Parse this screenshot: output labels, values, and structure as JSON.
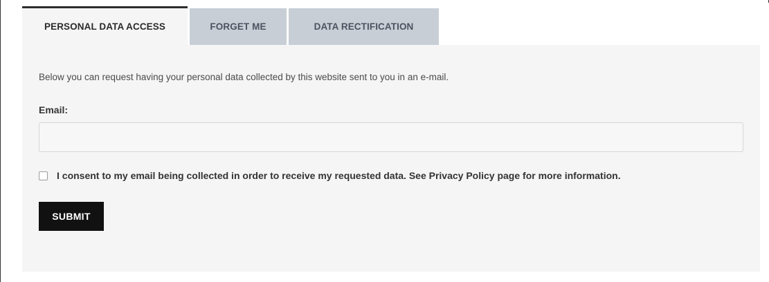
{
  "tabs": [
    {
      "label": "PERSONAL DATA ACCESS",
      "active": true
    },
    {
      "label": "FORGET ME",
      "active": false
    },
    {
      "label": "DATA RECTIFICATION",
      "active": false
    }
  ],
  "panel": {
    "intro": "Below you can request having your personal data collected by this website sent to you in an e-mail.",
    "email_label": "Email:",
    "email_value": "",
    "email_placeholder": "",
    "consent_checked": false,
    "consent_text": "I consent to my email being collected in order to receive my requested data. See Privacy Policy page for more information.",
    "submit_label": "SUBMIT"
  },
  "colors": {
    "tab_inactive_bg": "#c8ced6",
    "panel_bg": "#f5f5f5",
    "submit_bg": "#111111"
  }
}
